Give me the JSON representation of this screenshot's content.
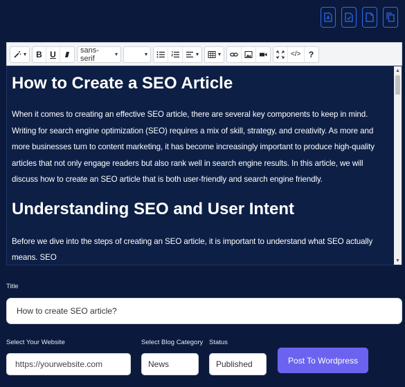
{
  "top_actions": [
    {
      "name": "export-pdf-icon"
    },
    {
      "name": "save-doc-icon"
    },
    {
      "name": "new-doc-icon"
    },
    {
      "name": "copy-icon"
    }
  ],
  "toolbar": {
    "font_family": "sans-serif",
    "font_size": "",
    "help_label": "?",
    "code_label": "</>",
    "bold_label": "B",
    "underline_label": "U"
  },
  "article": {
    "h1": "How to Create a  SEO Article",
    "p1": "When it comes to creating an effective SEO article, there are several key components to keep in mind. Writing for search engine optimization (SEO) requires a mix of skill, strategy, and creativity. As more and more businesses turn to content marketing, it has become increasingly important to produce high-quality articles that not only engage readers but also rank well in search engine results. In this article, we will discuss how to create an SEO article that is both user-friendly and search engine friendly.",
    "h2": "Understanding SEO and User Intent",
    "p2": "Before we dive into the steps of creating an SEO article, it is important to understand what SEO actually means. SEO"
  },
  "form": {
    "title_label": "Title",
    "title_value": "How to create SEO article?",
    "website_label": "Select Your Website",
    "website_placeholder": "https://yourwebsite.com",
    "category_label": "Select Blog Category",
    "category_value": "News",
    "status_label": "Status",
    "status_value": "Published",
    "post_button": "Post To Wordpress"
  },
  "colors": {
    "background": "#0b1a3c",
    "accent": "#2f6df6",
    "post_button": "#6b63f0"
  }
}
